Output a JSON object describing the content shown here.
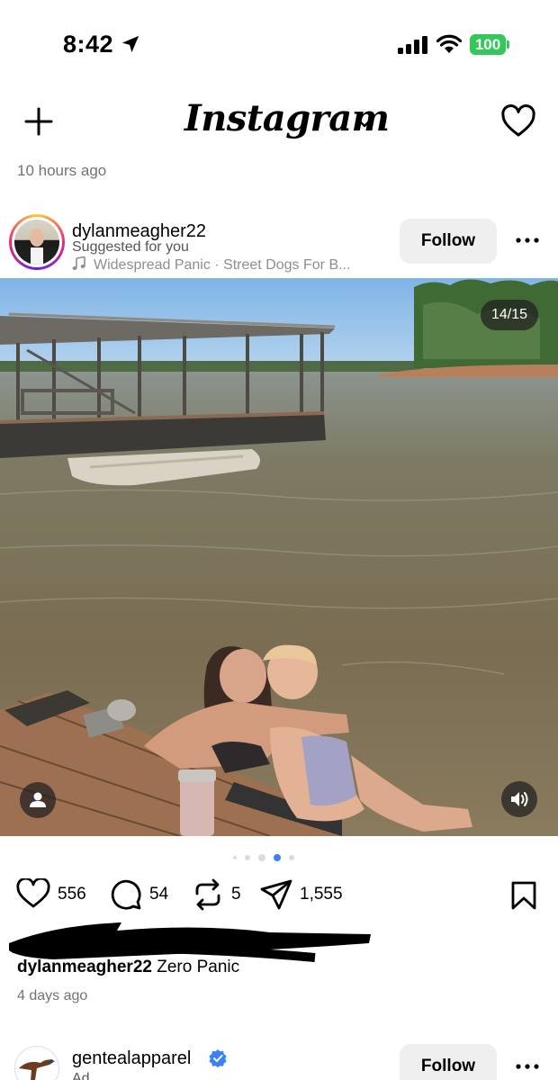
{
  "status_bar": {
    "time": "8:42",
    "battery": "100"
  },
  "header": {
    "brand": "Instagram"
  },
  "feed_meta": {
    "time_ago": "10 hours ago"
  },
  "post": {
    "username": "dylanmeagher22",
    "subtitle": "Suggested for you",
    "music": "Widespread Panic · Street Dogs For B...",
    "follow_label": "Follow",
    "media_counter": "14/15",
    "carousel_dot_count": 5,
    "carousel_active_index": 3,
    "likes": "556",
    "comments": "54",
    "reposts": "5",
    "shares": "1,555",
    "caption_user": "dylanmeagher22",
    "caption_text": "Zero Panic",
    "time_ago": "4 days ago"
  },
  "next_post": {
    "username": "gentealapparel",
    "subtitle": "Ad",
    "follow_label": "Follow"
  },
  "colors": {
    "accent_blue": "#3b82f6",
    "battery_green": "#34c759",
    "follow_bg": "#efefef"
  }
}
